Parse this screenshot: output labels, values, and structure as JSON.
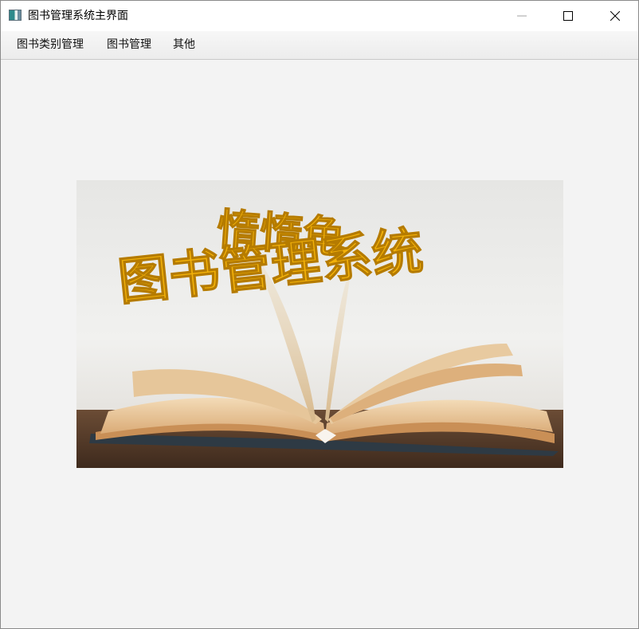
{
  "window": {
    "title": "图书管理系统主界面"
  },
  "menubar": {
    "items": [
      "图书类别管理",
      "图书管理",
      "其他"
    ]
  },
  "banner": {
    "line1": "惰惰龟",
    "line2": "图书管理系统"
  },
  "colors": {
    "banner_text": "#f2b10a",
    "background": "#f3f3f3"
  }
}
